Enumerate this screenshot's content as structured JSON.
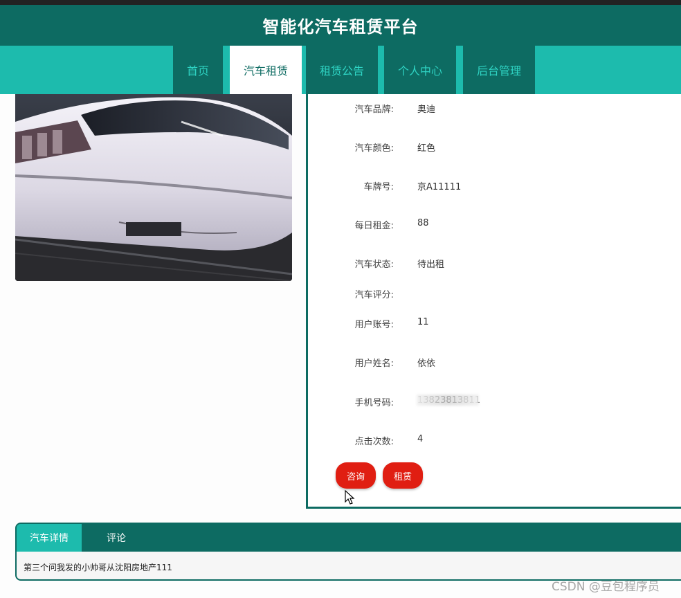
{
  "app_title": "智能化汽车租赁平台",
  "nav": [
    {
      "label": "首页"
    },
    {
      "label": "汽车租赁"
    },
    {
      "label": "租赁公告"
    },
    {
      "label": "个人中心"
    },
    {
      "label": "后台管理"
    }
  ],
  "nav_active": "汽车租赁",
  "details": [
    {
      "label": "汽车品牌:",
      "value": "奥迪"
    },
    {
      "label": "汽车颜色:",
      "value": "红色"
    },
    {
      "label": "车牌号:",
      "value": "京A11111"
    },
    {
      "label": "每日租金:",
      "value": "88"
    },
    {
      "label": "汽车状态:",
      "value": "待出租"
    },
    {
      "label": "汽车评分:",
      "value": ""
    },
    {
      "label": "用户账号:",
      "value": "11"
    },
    {
      "label": "用户姓名:",
      "value": "依依"
    },
    {
      "label": "手机号码:",
      "value": "13823813811"
    },
    {
      "label": "点击次数:",
      "value": "4"
    }
  ],
  "buttons": {
    "consult": "咨询",
    "rent": "租赁"
  },
  "tabs": [
    {
      "label": "汽车详情"
    },
    {
      "label": "评论"
    }
  ],
  "tab_content": "第三个问我发的小帅哥从沈阳房地产111",
  "watermark": "CSDN @豆包程序员",
  "colors": {
    "primary": "#0d6b62",
    "accent": "#1dbbad",
    "button": "#e01e12"
  }
}
